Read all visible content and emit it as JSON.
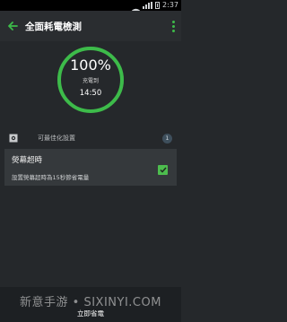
{
  "status_bar": {
    "time": "2:37"
  },
  "header": {
    "title": "全面耗電檢測"
  },
  "battery": {
    "percent_label": "100%",
    "status_label": "充電到",
    "time_label": "14:50",
    "level": 1.0
  },
  "section": {
    "label": "可最佳化設置",
    "count": "1"
  },
  "card": {
    "title": "熒幕超時",
    "description": "設置熒幕超時為15秒節省電量",
    "checked": true
  },
  "footer": {
    "button_label": "立即省電"
  },
  "watermark": {
    "text": "新意手游 • SIXINYI.COM"
  },
  "colors": {
    "accent": "#3dbb4a",
    "background": "#25282b",
    "card": "#35393c"
  }
}
